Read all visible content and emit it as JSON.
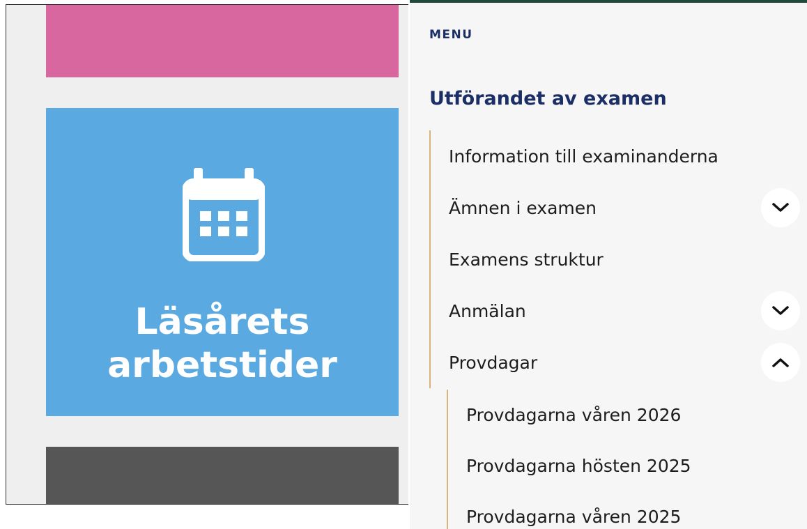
{
  "left": {
    "tile": {
      "icon": "calendar-icon",
      "title_line1": "Läsårets",
      "title_line2": "arbetstider"
    }
  },
  "menu": {
    "header": "MENU",
    "section_title": "Utförandet av examen",
    "items": [
      {
        "label": "Information till examinanderna",
        "toggle": null
      },
      {
        "label": "Ämnen i examen",
        "toggle": "chevron-down-icon"
      },
      {
        "label": "Examens struktur",
        "toggle": null
      },
      {
        "label": "Anmälan",
        "toggle": "chevron-down-icon"
      },
      {
        "label": "Provdagar",
        "toggle": "chevron-up-icon"
      }
    ],
    "subitems": [
      {
        "label": "Provdagarna våren 2026"
      },
      {
        "label": "Provdagarna hösten 2025"
      },
      {
        "label": "Provdagarna våren 2025"
      }
    ]
  },
  "colors": {
    "pink_tile": "#d9679f",
    "blue_tile": "#5aa9e1",
    "dark_tile": "#565656",
    "menu_title": "#1b2f66",
    "accent_line": "#d8b37a",
    "top_border": "#1f4a3c"
  }
}
